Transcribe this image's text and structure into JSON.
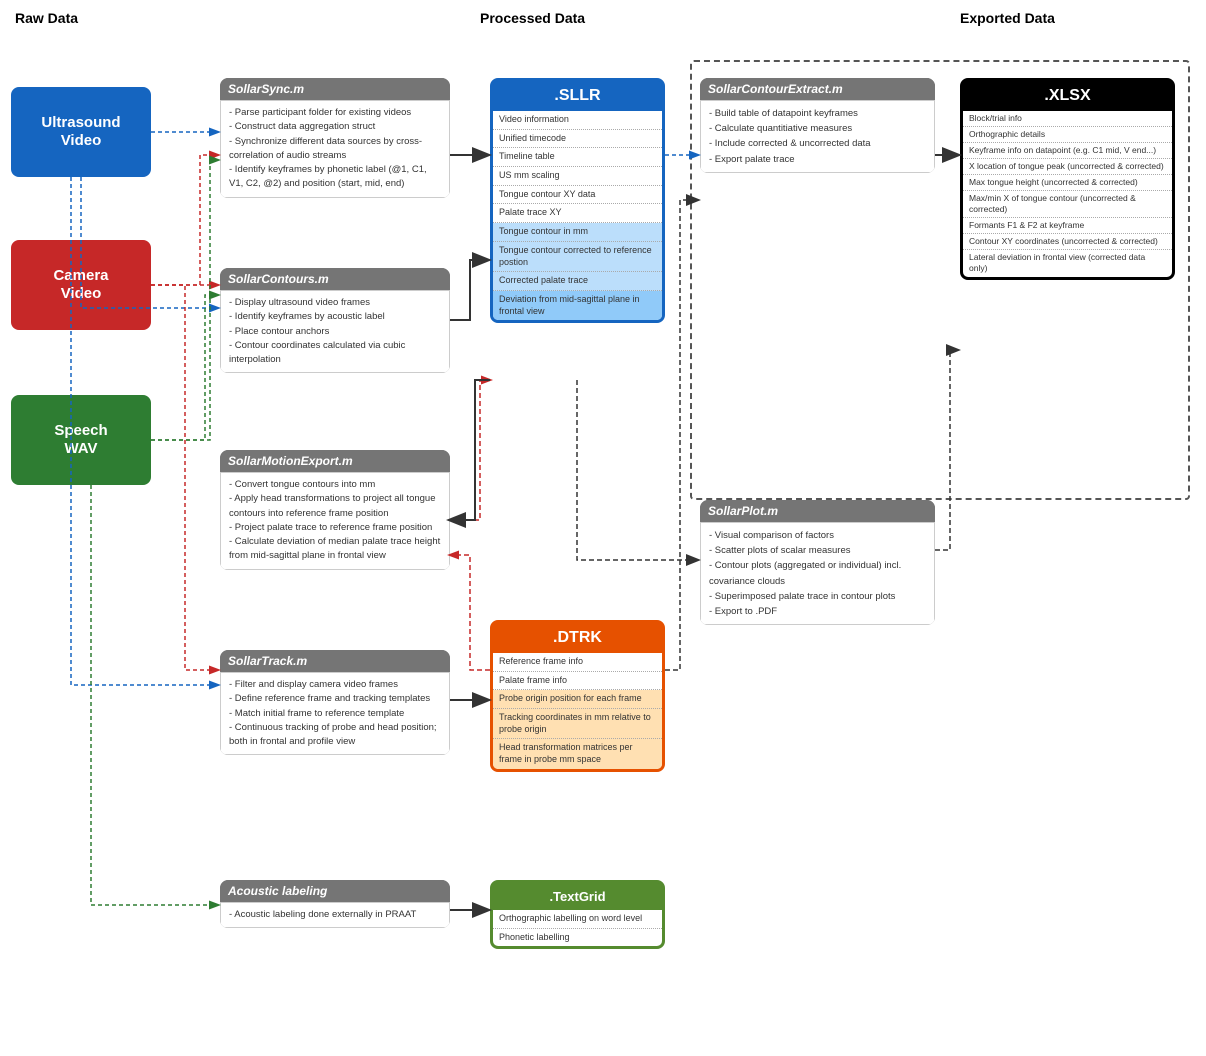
{
  "headers": {
    "raw": "Raw Data",
    "processed": "Processed Data",
    "exported": "Exported Data"
  },
  "inputs": {
    "ultrasound": {
      "label": "Ultrasound\nVideo",
      "color": "#1565c0"
    },
    "camera": {
      "label": "Camera\nVideo",
      "color": "#c62828"
    },
    "speech": {
      "label": "Speech\nWAV",
      "color": "#2e7d32"
    }
  },
  "modules": {
    "sollarSync": {
      "title": "SollarSync.m",
      "items": [
        "- Parse participant folder for existing videos",
        "- Construct data aggregation struct",
        "- Synchronize different data sources by",
        "  cross-correlation of audio streams",
        "- Identify keyframes by phonetic label (@1, C1, V1,",
        "  C2, @2) and position (start, mid, end)"
      ]
    },
    "sollarContours": {
      "title": "SollarContours.m",
      "items": [
        "- Display ultrasound video frames",
        "- Identify keyframes by acoustic label",
        "- Place contour anchors",
        "- Contour coordinates calculated via cubic",
        "  interpolation"
      ]
    },
    "sollarMotionExport": {
      "title": "SollarMotionExport.m",
      "items": [
        "- Convert tongue contours into mm",
        "- Apply head transformations to project all tongue",
        "  contours into reference frame position",
        "- Project palate trace to reference frame position",
        "- Calculate deviation of median palate trace height",
        "  from mid-sagittal plane in frontal view"
      ]
    },
    "sollarTrack": {
      "title": "SollarTrack.m",
      "items": [
        "- Filter and display camera video frames",
        "- Define reference frame and tracking templates",
        "- Match initial frame to reference template",
        "- Continuous tracking of probe and head position;",
        "  both in frontal and profile view"
      ]
    },
    "acousticLabeling": {
      "title": "Acoustic labeling",
      "items": [
        "- Acoustic labeling done externally in PRAAT"
      ]
    }
  },
  "sllr": {
    "title": ".SLLR",
    "items": [
      "Video information",
      "Unified timecode",
      "Timeline table",
      "US mm scaling",
      "Tongue contour XY data",
      "Palate trace XY",
      "Tongue contour in mm",
      "Tongue contour corrected to\nreference postion",
      "Corrected palate trace",
      "Deviation from mid-sagittal\nplane in frontal view"
    ],
    "highlighted": [
      6,
      7,
      8,
      9
    ]
  },
  "dtrk": {
    "title": ".DTRK",
    "items": [
      "Reference frame info",
      "Palate frame info",
      "Probe origin position for each\nframe",
      "Tracking coordinates in mm\nrelative to probe origin",
      "Head transformation matrices\nper frame in probe mm space"
    ],
    "highlighted": [
      2,
      3,
      4
    ]
  },
  "textgrid": {
    "title": ".TextGrid",
    "items": [
      "Orthographic labelling on\nword level",
      "Phonetic labelling"
    ]
  },
  "xlsx": {
    "title": ".XLSX",
    "items": [
      "Block/trial info",
      "Orthographic details",
      "Keyframe info on datapoint\n(e.g. C1 mid, V end...)",
      "X location of tongue peak\n(uncorrected & corrected)",
      "Max tongue height\n(uncorrected & corrected)",
      "Max/min X of tongue contour\n(uncorrected & corrected)",
      "Formants F1 & F2 at keyframe",
      "Contour XY coordinates\n(uncorrected & corrected)",
      "Lateral deviation in frontal view\n(corrected data only)"
    ]
  },
  "contourExtract": {
    "title": "SollarContourExtract.m",
    "items": [
      "- Build table of datapoint keyframes",
      "- Calculate quantitiative measures",
      "- Include corrected & uncorrected data",
      "- Export palate trace"
    ]
  },
  "sollarPlot": {
    "title": "SollarPlot.m",
    "items": [
      "- Visual comparison of factors",
      "- Scatter plots of scalar measures",
      "- Contour plots (aggregated or individual) incl.",
      "  covariance clouds",
      "- Superimposed palate trace in contour plots",
      "- Export to .PDF"
    ]
  }
}
